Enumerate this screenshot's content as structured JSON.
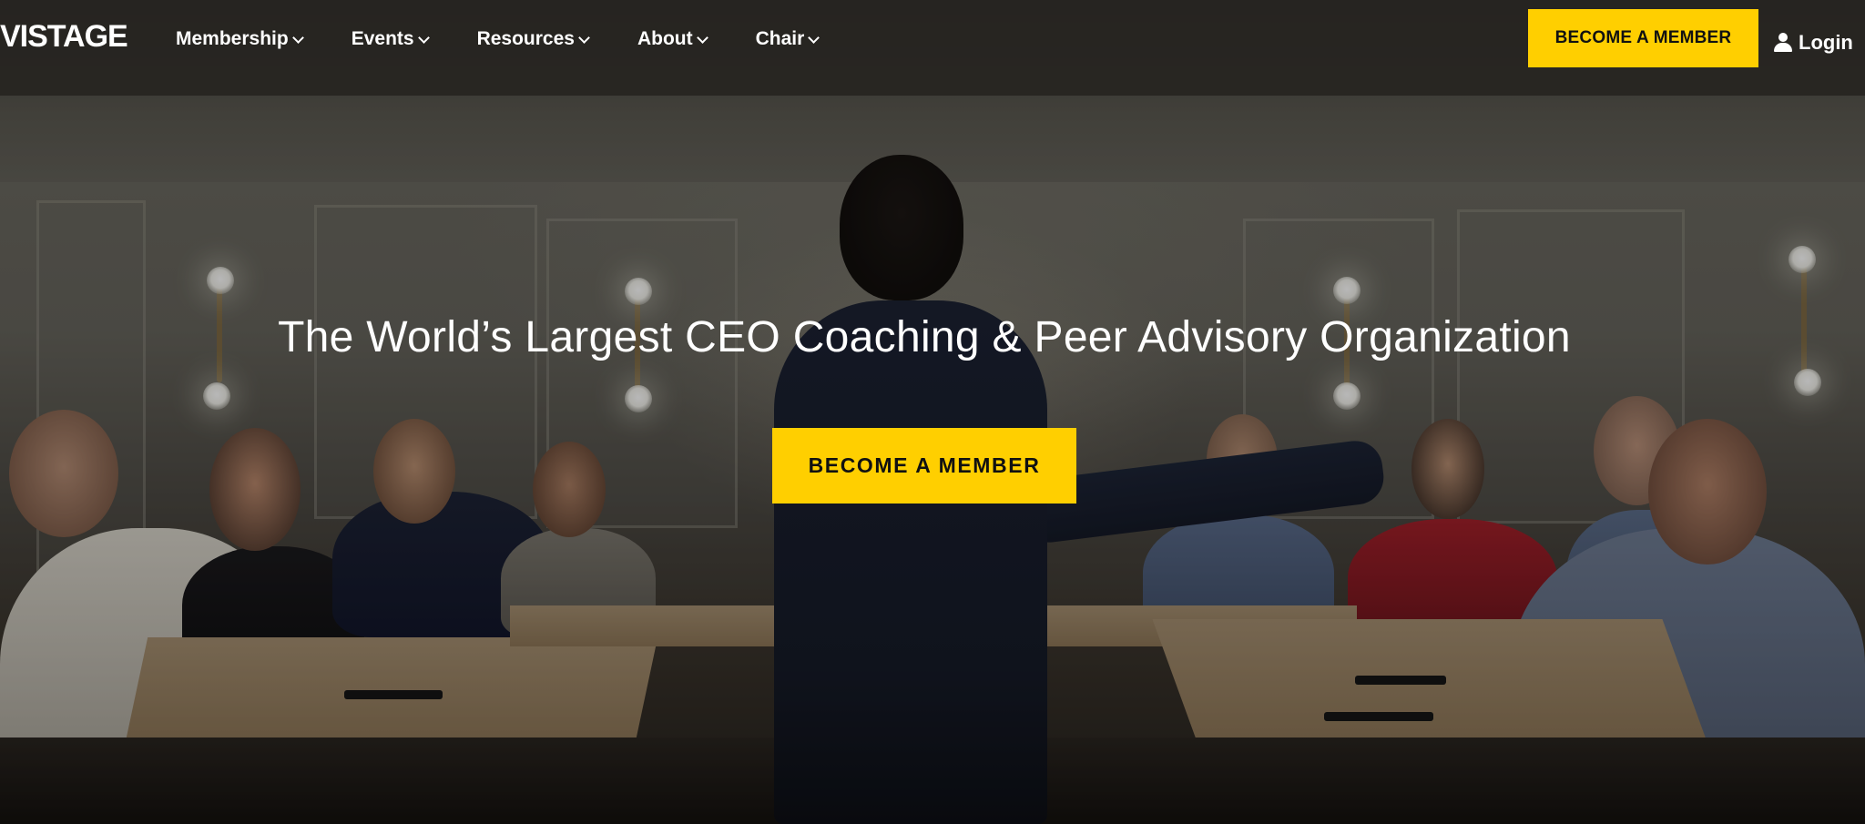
{
  "brand": {
    "logo_text": "VISTAGE"
  },
  "nav": {
    "items": [
      {
        "label": "Membership"
      },
      {
        "label": "Events"
      },
      {
        "label": "Resources"
      },
      {
        "label": "About"
      },
      {
        "label": "Chair"
      }
    ]
  },
  "header": {
    "cta_label": "BECOME A MEMBER",
    "login_label": "Login"
  },
  "hero": {
    "title": "The World’s Largest CEO Coaching & Peer Advisory Organization",
    "cta_label": "BECOME A MEMBER"
  },
  "colors": {
    "accent": "#ffcf00",
    "header_bg": "#262320",
    "text_light": "#ffffff",
    "button_text": "#111111"
  },
  "icons": {
    "nav_dropdown": "chevron-down-icon",
    "login": "user-icon"
  }
}
